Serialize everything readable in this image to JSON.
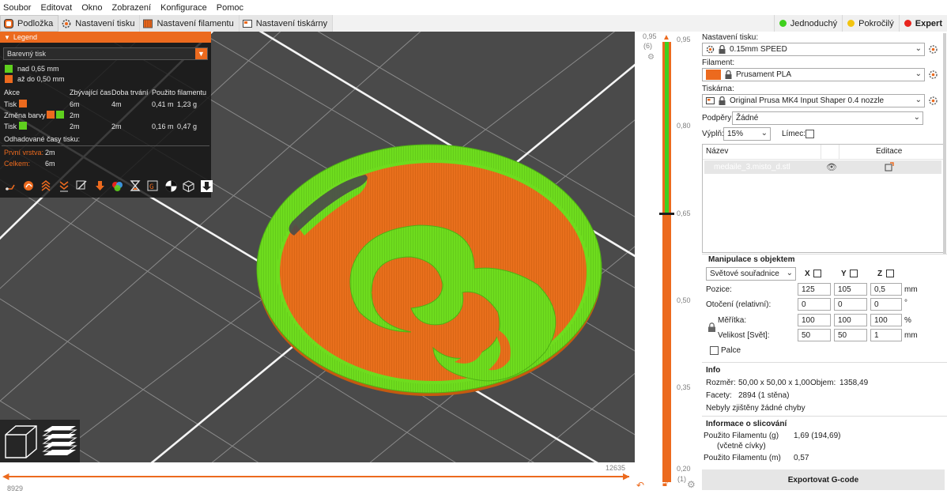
{
  "menu": [
    "Soubor",
    "Editovat",
    "Okno",
    "Zobrazení",
    "Konfigurace",
    "Pomoc"
  ],
  "tabs": [
    {
      "label": "Podložka",
      "icon": "plater-icon"
    },
    {
      "label": "Nastavení tisku",
      "icon": "gear-icon"
    },
    {
      "label": "Nastavení filamentu",
      "icon": "filament-spool-icon"
    },
    {
      "label": "Nastavení tiskárny",
      "icon": "printer-icon"
    }
  ],
  "modes": [
    {
      "label": "Jednoduchý",
      "color": "#3fd01e"
    },
    {
      "label": "Pokročilý",
      "color": "#f2c40f"
    },
    {
      "label": "Expert",
      "color": "#e8241e"
    }
  ],
  "legend": {
    "title": "Legend",
    "view_type": "Barevný tisk",
    "items": [
      {
        "color": "#5fd01e",
        "label": "nad 0,65 mm"
      },
      {
        "color": "#ec6a1e",
        "label": "až do 0,50 mm"
      }
    ],
    "columns": [
      "Akce",
      "Zbývající čas",
      "Doba trvání",
      "Použito filamentu"
    ],
    "rows": [
      {
        "action": "Tisk",
        "colors": [
          "#ec6a1e"
        ],
        "remaining": "6m",
        "duration": "4m",
        "length": "0,41 m",
        "weight": "1,23 g"
      },
      {
        "action": "Změna barvy",
        "colors": [
          "#ec6a1e",
          "#5fd01e"
        ],
        "remaining": "2m",
        "duration": "",
        "length": "",
        "weight": ""
      },
      {
        "action": "Tisk",
        "colors": [
          "#5fd01e"
        ],
        "remaining": "2m",
        "duration": "2m",
        "length": "0,16 m",
        "weight": "0,47 g"
      }
    ],
    "estimated_title": "Odhadované časy tisku:",
    "first_layer_label": "První vrstva:",
    "first_layer_value": "2m",
    "total_label": "Celkem:",
    "total_value": "6m",
    "toolbar_icons": [
      "travel-icon",
      "wipe-icon",
      "retractions-icon",
      "deretractions-icon",
      "seams-icon",
      "tool-changes-icon",
      "color-changes-icon",
      "pause-icon",
      "custom-gcode-icon",
      "center-of-gravity-icon",
      "shells-icon",
      "tool-marker-icon"
    ]
  },
  "hslider": {
    "left_value": "8929",
    "right_value": "12635"
  },
  "vslider": {
    "top_value": "0,95",
    "top_sub": "(6)",
    "top_right": "0,95",
    "ticks": [
      "0,80",
      "0,65",
      "0,50",
      "0,35"
    ],
    "bottom_value": "0,20",
    "bottom_sub": "(1)",
    "color_change_at": 0.65
  },
  "panel": {
    "print_settings_label": "Nastavení tisku:",
    "print_settings_value": "0.15mm SPEED",
    "filament_label": "Filament:",
    "filament_value": "Prusament PLA",
    "filament_color": "#ec6a1e",
    "printer_label": "Tiskárna:",
    "printer_value": "Original Prusa MK4 Input Shaper 0.4 nozzle",
    "supports_label": "Podpěry:",
    "supports_value": "Žádné",
    "infill_label": "Výplň:",
    "infill_value": "15%",
    "brim_label": "Límec:",
    "list_header_name": "Název",
    "list_header_edit": "Editace",
    "object_name": "medaile_3.misto_d.stl",
    "manip_title": "Manipulace s objektem",
    "coords_value": "Světové souřadnice",
    "axis_x": "X",
    "axis_y": "Y",
    "axis_z": "Z",
    "position_label": "Pozice:",
    "position": [
      "125",
      "105",
      "0,5"
    ],
    "position_unit": "mm",
    "rotation_label": "Otočení (relativní):",
    "rotation": [
      "0",
      "0",
      "0"
    ],
    "rotation_unit": "°",
    "scale_label": "Měřítka:",
    "scale": [
      "100",
      "100",
      "100"
    ],
    "scale_unit": "%",
    "size_label": "Velikost [Svět]:",
    "size": [
      "50",
      "50",
      "1"
    ],
    "size_unit": "mm",
    "inches_label": "Palce",
    "info_title": "Info",
    "dims_label": "Rozměr:",
    "dims_value": "50,00 x 50,00 x 1,00",
    "volume_label": "Objem:",
    "volume_value": "1358,49",
    "facets_label": "Facety:",
    "facets_value": "2894 (1 stěna)",
    "errors_text": "Nebyly zjištěny žádné chyby",
    "slice_title": "Informace o slicování",
    "used_g_label": "Použito Filamentu (g)",
    "used_g_value": "1,69 (194,69)",
    "used_g_sub": "(včetně cívky)",
    "used_m_label": "Použito Filamentu (m)",
    "used_m_value": "0,57",
    "export_label": "Exportovat G-code"
  }
}
